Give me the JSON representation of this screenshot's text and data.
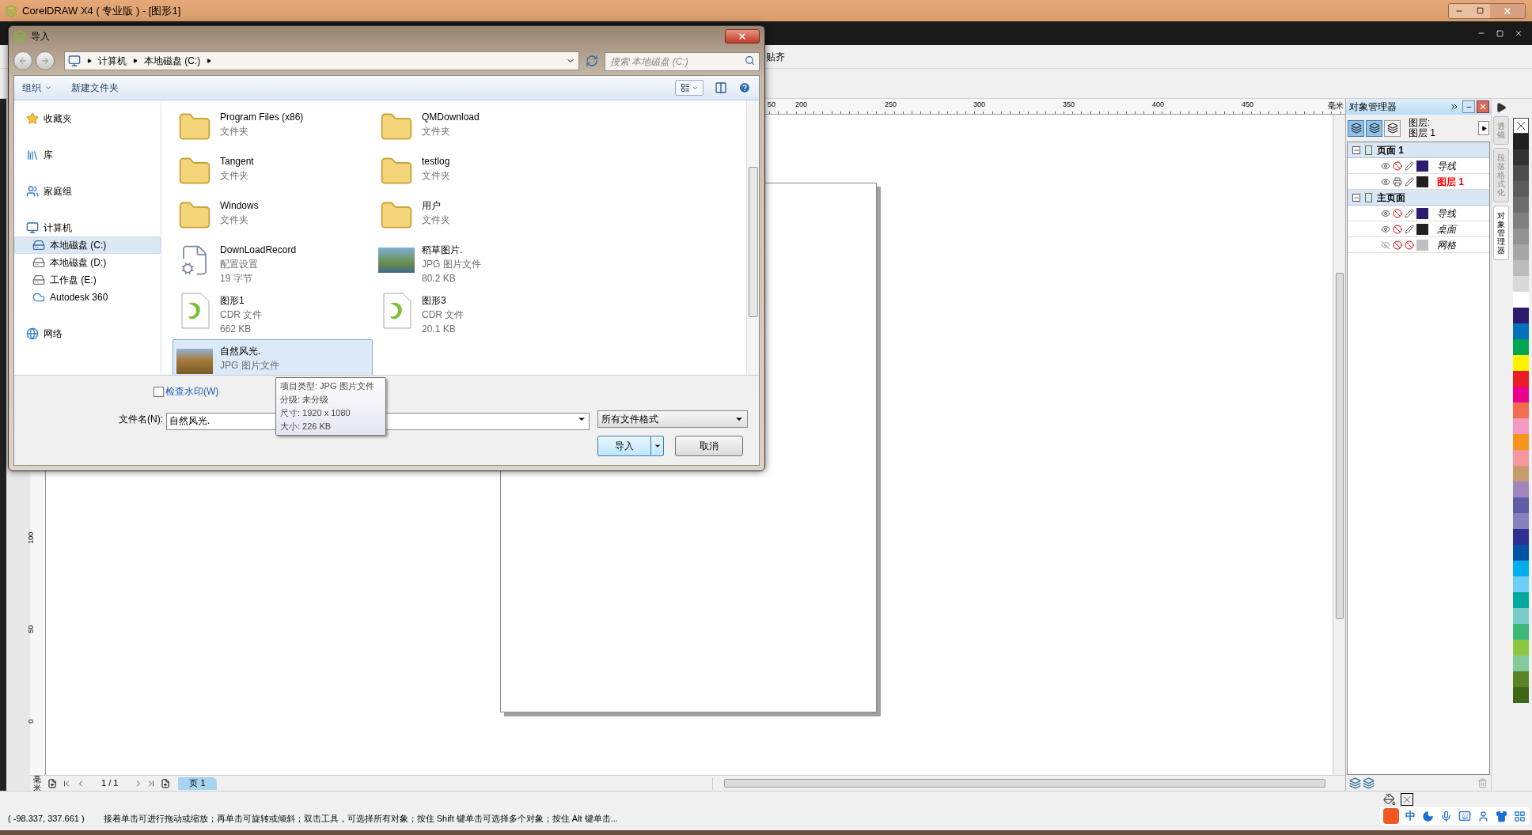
{
  "app": {
    "title": "CorelDRAW X4 ( 专业版 ) - [图形1]",
    "snap_menu": "贴齐"
  },
  "ruler": {
    "h_labels": [
      "50",
      "200",
      "250",
      "300",
      "350",
      "400",
      "450"
    ],
    "h_unit": "毫米",
    "v_labels": [
      "100",
      "50",
      "0"
    ],
    "v_unit": "毫米"
  },
  "object_manager": {
    "title": "对象管理器",
    "layer_caption": "图层:",
    "current_layer": "图层 1",
    "view_buttons": [
      {
        "selected": true
      },
      {
        "selected": true
      },
      {
        "selected": false
      }
    ],
    "tree": [
      {
        "label": "页面 1",
        "expanded": true,
        "children": [
          {
            "label": "导线",
            "color": "#2e1a6e",
            "visible": true,
            "printable": false,
            "editable": true,
            "active": false
          },
          {
            "label": "图层 1",
            "color": "#231f20",
            "visible": true,
            "printable": true,
            "editable": true,
            "active": true
          }
        ]
      },
      {
        "label": "主页面",
        "expanded": true,
        "children": [
          {
            "label": "导线",
            "color": "#2e1a6e",
            "visible": true,
            "printable": false,
            "editable": true,
            "active": false
          },
          {
            "label": "桌面",
            "color": "#231f20",
            "visible": true,
            "printable": false,
            "editable": true,
            "active": false
          },
          {
            "label": "网格",
            "color": "#c0c0c0",
            "visible": false,
            "printable": false,
            "editable": false,
            "active": false
          }
        ]
      }
    ]
  },
  "docker_tabs": [
    {
      "label": "透镜",
      "selected": false
    },
    {
      "label": "段落格式化",
      "selected": false
    },
    {
      "label": "对象管理器",
      "selected": true
    }
  ],
  "palette": [
    {
      "kind": "none"
    },
    {
      "kind": "swatch",
      "color": "#231f20"
    },
    {
      "kind": "swatch",
      "color": "#333333"
    },
    {
      "kind": "swatch",
      "color": "#4d4d4d"
    },
    {
      "kind": "swatch",
      "color": "#5c5c5c"
    },
    {
      "kind": "swatch",
      "color": "#6d6d6d"
    },
    {
      "kind": "swatch",
      "color": "#808080"
    },
    {
      "kind": "swatch",
      "color": "#939393"
    },
    {
      "kind": "swatch",
      "color": "#a6a6a6"
    },
    {
      "kind": "swatch",
      "color": "#bcbcbc"
    },
    {
      "kind": "swatch",
      "color": "#d9d9d9"
    },
    {
      "kind": "swatch",
      "color": "#ffffff"
    },
    {
      "kind": "swatch",
      "color": "#2e1a6e"
    },
    {
      "kind": "swatch",
      "color": "#0072bc"
    },
    {
      "kind": "swatch",
      "color": "#00a651"
    },
    {
      "kind": "swatch",
      "color": "#fff200"
    },
    {
      "kind": "swatch",
      "color": "#ed1c24"
    },
    {
      "kind": "swatch",
      "color": "#ec008c"
    },
    {
      "kind": "swatch",
      "color": "#f26c4f"
    },
    {
      "kind": "swatch",
      "color": "#f49ac1"
    },
    {
      "kind": "swatch",
      "color": "#f7941d"
    },
    {
      "kind": "swatch",
      "color": "#f5989d"
    },
    {
      "kind": "swatch",
      "color": "#c69c6d"
    },
    {
      "kind": "swatch",
      "color": "#a186be"
    },
    {
      "kind": "swatch",
      "color": "#605ca8"
    },
    {
      "kind": "swatch",
      "color": "#8781bd"
    },
    {
      "kind": "swatch",
      "color": "#2e3192"
    },
    {
      "kind": "swatch",
      "color": "#0054a6"
    },
    {
      "kind": "swatch",
      "color": "#00aeef"
    },
    {
      "kind": "swatch",
      "color": "#6dcff6"
    },
    {
      "kind": "swatch",
      "color": "#00a99d"
    },
    {
      "kind": "swatch",
      "color": "#7accc8"
    },
    {
      "kind": "swatch",
      "color": "#3cb878"
    },
    {
      "kind": "swatch",
      "color": "#8dc63f"
    },
    {
      "kind": "swatch",
      "color": "#82ca9c"
    },
    {
      "kind": "swatch",
      "color": "#598527"
    },
    {
      "kind": "swatch",
      "color": "#406618"
    }
  ],
  "page_nav": {
    "counter": "1 / 1",
    "tabs": [
      {
        "label": "页 1",
        "selected": true
      }
    ]
  },
  "status_bar": {
    "coordinates": "( -98.337, 337.661 )",
    "hint": "接着单击可进行拖动或缩放；再单击可旋转或倾斜；双击工具，可选择所有对象；按住 Shift 键单击可选择多个对象；按住 Alt 键单击..."
  },
  "ime": {
    "mode": "中"
  },
  "dialog": {
    "title": "导入",
    "breadcrumb": [
      "计算机",
      "本地磁盘 (C:)"
    ],
    "search": {
      "placeholder": "搜索 本地磁盘 (C:)"
    },
    "toolbar": [
      {
        "label": "组织",
        "kind": "menu"
      },
      {
        "label": "新建文件夹",
        "kind": "button"
      }
    ],
    "nav": [
      {
        "label": "收藏夹",
        "kind": "star",
        "selected": false
      },
      {
        "label": "库",
        "kind": "library",
        "selected": false
      },
      {
        "label": "家庭组",
        "kind": "homegroup",
        "selected": false
      },
      {
        "label": "计算机",
        "kind": "computer",
        "selected": false,
        "children": [
          {
            "label": "本地磁盘 (C:)",
            "kind": "system-drive",
            "selected": true
          },
          {
            "label": "本地磁盘 (D:)",
            "kind": "drive",
            "selected": false
          },
          {
            "label": "工作盘 (E:)",
            "kind": "drive",
            "selected": false
          },
          {
            "label": "Autodesk 360",
            "kind": "cloud",
            "selected": false
          }
        ]
      },
      {
        "label": "网络",
        "kind": "network",
        "selected": false
      }
    ],
    "files": [
      {
        "name": "Program Files (x86)",
        "type": "文件夹",
        "kind": "folder",
        "selected": false
      },
      {
        "name": "QMDownload",
        "type": "文件夹",
        "kind": "folder",
        "selected": false
      },
      {
        "name": "Tangent",
        "type": "文件夹",
        "kind": "folder",
        "selected": false
      },
      {
        "name": "testlog",
        "type": "文件夹",
        "kind": "folder",
        "selected": false
      },
      {
        "name": "Windows",
        "type": "文件夹",
        "kind": "folder",
        "selected": false
      },
      {
        "name": "用户",
        "type": "文件夹",
        "kind": "folder",
        "selected": false
      },
      {
        "name": "DownLoadRecord",
        "type": "配置设置",
        "size": "19 字节",
        "kind": "config",
        "selected": false
      },
      {
        "name": "稻草图片.",
        "type": "JPG 图片文件",
        "size": "80.2 KB",
        "kind": "photo",
        "selected": false
      },
      {
        "name": "图形1",
        "type": "CDR 文件",
        "size": "662 KB",
        "kind": "cdr",
        "selected": false
      },
      {
        "name": "图形3",
        "type": "CDR 文件",
        "size": "20.1 KB",
        "kind": "cdr",
        "selected": false
      },
      {
        "name": "自然风光.",
        "type": "JPG 图片文件",
        "kind": "photo",
        "selected": true
      }
    ],
    "watermark_check": {
      "label": "检查水印(W)",
      "checked": false
    },
    "filename": {
      "label": "文件名(N):",
      "value": "自然风光."
    },
    "filetype": "所有文件格式",
    "buttons": [
      {
        "label": "导入",
        "kind": "split"
      },
      {
        "label": "取消",
        "kind": "plain"
      }
    ],
    "tooltip": [
      "项目类型: JPG 图片文件",
      "分级: 未分级",
      "尺寸: 1920 x 1080",
      "大小: 226 KB"
    ]
  }
}
